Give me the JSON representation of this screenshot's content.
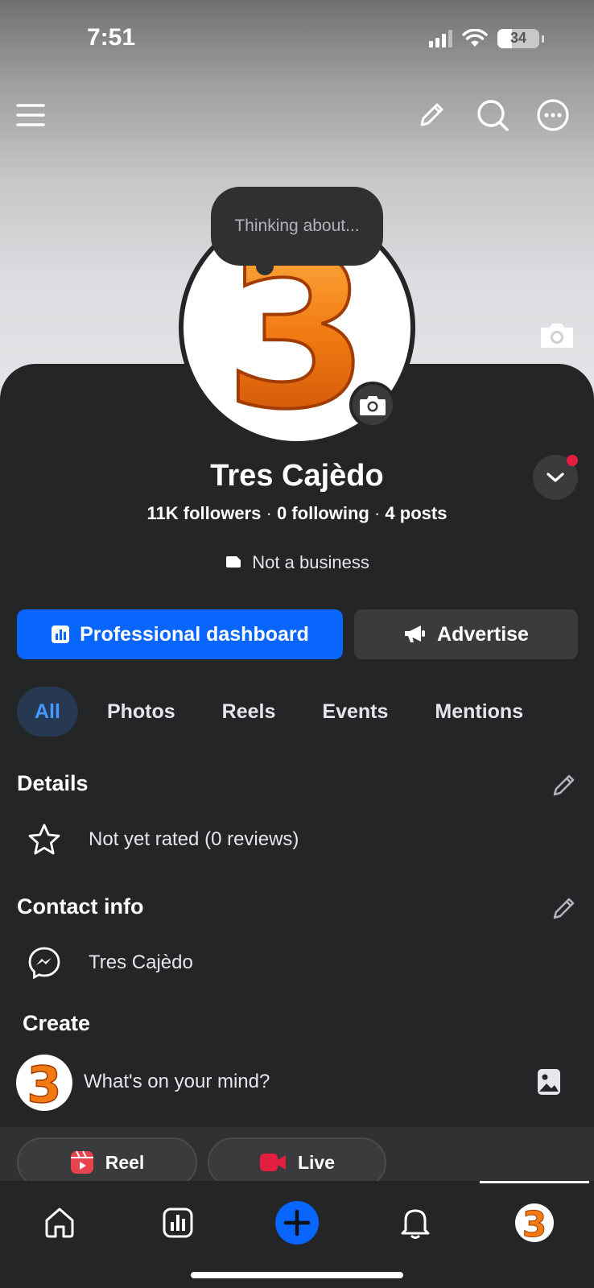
{
  "status_bar": {
    "time": "7:51",
    "battery": "34",
    "battery_level": 0.34
  },
  "top_nav": {
    "menu_icon": "hamburger-menu-icon",
    "edit_icon": "pencil-icon",
    "search_icon": "search-icon",
    "more_icon": "more-options-icon"
  },
  "profile": {
    "note": "Thinking about...",
    "name": "Tres Cajèdo",
    "followers": "11K",
    "followers_label": "followers",
    "following": "0",
    "following_label": "following",
    "posts": "4",
    "posts_label": "posts",
    "separator": "·",
    "category": "Not a business",
    "avatar_glyph": "3"
  },
  "actions": {
    "primary": "Professional dashboard",
    "secondary": "Advertise"
  },
  "tabs": [
    {
      "label": "All",
      "active": true
    },
    {
      "label": "Photos"
    },
    {
      "label": "Reels"
    },
    {
      "label": "Events"
    },
    {
      "label": "Mentions"
    }
  ],
  "details": {
    "title": "Details",
    "rating": "Not yet rated (0 reviews)"
  },
  "contact": {
    "title": "Contact info",
    "messenger": "Tres Cajèdo"
  },
  "create": {
    "title": "Create",
    "placeholder": "What's on your mind?",
    "reel": "Reel",
    "live": "Live"
  },
  "bottom_nav": [
    "home-icon",
    "dashboard-icon",
    "create-plus-icon",
    "notifications-bell-icon",
    "profile-avatar-icon"
  ],
  "colors": {
    "accent": "#0866ff",
    "background": "#242527",
    "tab_active_text": "#4599ff",
    "reel": "#e8424e",
    "live": "#e41e3f"
  }
}
